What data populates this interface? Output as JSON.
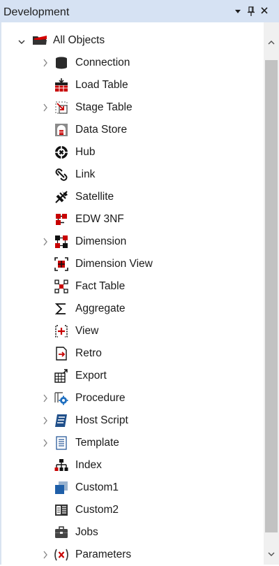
{
  "panel": {
    "title": "Development",
    "buttons": {
      "dropdown": "▾",
      "pin": "⊥",
      "close": "×"
    }
  },
  "tree": {
    "root": {
      "label": "All Objects",
      "expanded": true,
      "icon": "folder-icon"
    },
    "items": [
      {
        "label": "Connection",
        "expandable": true,
        "icon": "database-icon"
      },
      {
        "label": "Load Table",
        "expandable": false,
        "icon": "load-table-icon"
      },
      {
        "label": "Stage Table",
        "expandable": true,
        "icon": "stage-table-icon"
      },
      {
        "label": "Data Store",
        "expandable": false,
        "icon": "data-store-icon"
      },
      {
        "label": "Hub",
        "expandable": false,
        "icon": "hub-icon"
      },
      {
        "label": "Link",
        "expandable": false,
        "icon": "link-icon"
      },
      {
        "label": "Satellite",
        "expandable": false,
        "icon": "satellite-icon"
      },
      {
        "label": "EDW 3NF",
        "expandable": false,
        "icon": "edw-icon"
      },
      {
        "label": "Dimension",
        "expandable": true,
        "icon": "dimension-icon"
      },
      {
        "label": "Dimension View",
        "expandable": false,
        "icon": "dimension-view-icon"
      },
      {
        "label": "Fact Table",
        "expandable": false,
        "icon": "fact-table-icon"
      },
      {
        "label": "Aggregate",
        "expandable": false,
        "icon": "sigma-icon"
      },
      {
        "label": "View",
        "expandable": false,
        "icon": "view-icon"
      },
      {
        "label": "Retro",
        "expandable": false,
        "icon": "retro-icon"
      },
      {
        "label": "Export",
        "expandable": false,
        "icon": "export-icon"
      },
      {
        "label": "Procedure",
        "expandable": true,
        "icon": "procedure-icon"
      },
      {
        "label": "Host Script",
        "expandable": true,
        "icon": "host-script-icon"
      },
      {
        "label": "Template",
        "expandable": true,
        "icon": "template-icon"
      },
      {
        "label": "Index",
        "expandable": false,
        "icon": "index-icon"
      },
      {
        "label": "Custom1",
        "expandable": false,
        "icon": "custom1-icon"
      },
      {
        "label": "Custom2",
        "expandable": false,
        "icon": "custom2-icon"
      },
      {
        "label": "Jobs",
        "expandable": false,
        "icon": "jobs-icon"
      },
      {
        "label": "Parameters",
        "expandable": true,
        "icon": "parameters-icon"
      }
    ]
  },
  "colors": {
    "accent_red": "#c80000",
    "dark": "#1e1e1e",
    "blue": "#1f6fc0",
    "title_bar": "#d6e2f3",
    "scroll_thumb": "#c2c2c2"
  }
}
